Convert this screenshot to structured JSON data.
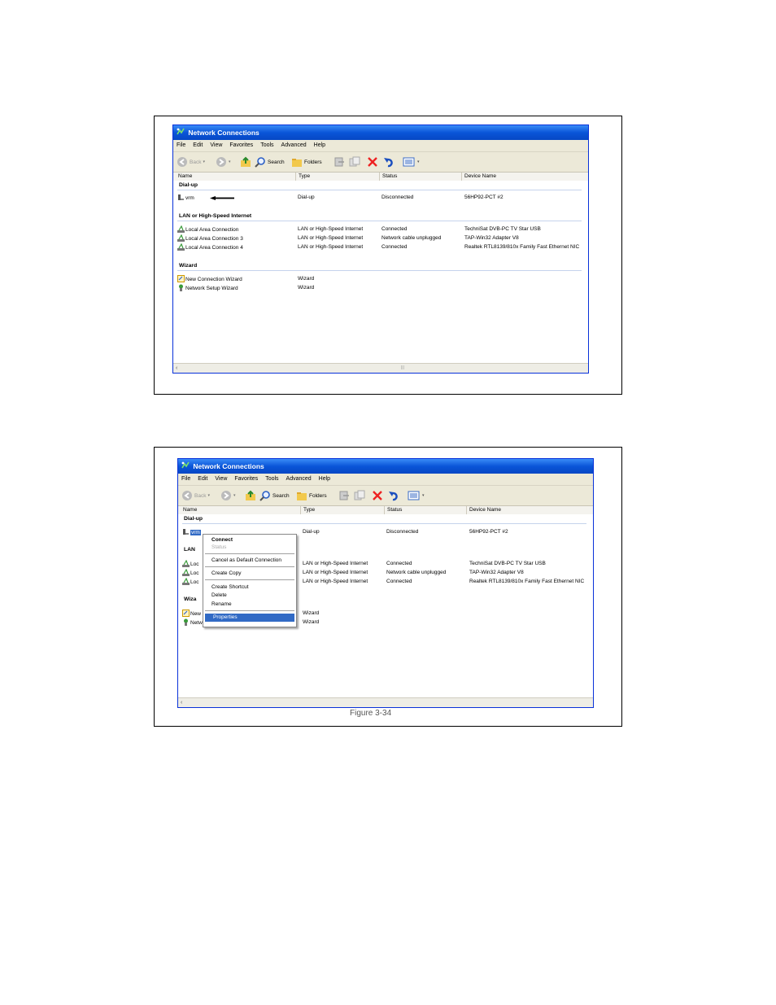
{
  "window": {
    "title": "Network Connections"
  },
  "menu": [
    "File",
    "Edit",
    "View",
    "Favorites",
    "Tools",
    "Advanced",
    "Help"
  ],
  "toolbar": {
    "back": "Back",
    "search": "Search",
    "folders": "Folders"
  },
  "columns": [
    "Name",
    "Type",
    "Status",
    "Device Name"
  ],
  "groups": {
    "dialup": "Dial-up",
    "lan": "LAN or High-Speed Internet",
    "wizard": "Wizard"
  },
  "dialup_row": {
    "name": "vrm",
    "type": "Dial-up",
    "status": "Disconnected",
    "device": "56HP92-PCT #2"
  },
  "lan_rows": [
    {
      "name": "Local Area Connection",
      "type": "LAN or High-Speed Internet",
      "status": "Connected",
      "device": "TechniSat DVB-PC TV Star USB"
    },
    {
      "name": "Local Area Connection 3",
      "type": "LAN or High-Speed Internet",
      "status": "Network cable unplugged",
      "device": "TAP-Win32 Adapter V8"
    },
    {
      "name": "Local Area Connection 4",
      "type": "LAN or High-Speed Internet",
      "status": "Connected",
      "device": "Realtek RTL8139/810x Family Fast Ethernet NIC"
    }
  ],
  "wizard_rows": [
    {
      "name": "New Connection Wizard",
      "type": "Wizard"
    },
    {
      "name": "Network Setup Wizard",
      "type": "Wizard"
    }
  ],
  "truncated": {
    "lan_row": "Loc",
    "wizard_group": "Wiza",
    "new_wizard": "New",
    "lan_group": "LAN"
  },
  "context_menu": {
    "connect": "Connect",
    "status": "Status",
    "cancel_default": "Cancel as Default Connection",
    "create_copy": "Create Copy",
    "create_shortcut": "Create Shortcut",
    "delete": "Delete",
    "rename": "Rename",
    "properties": "Properties"
  },
  "caption": "Figure 3-34",
  "colors": {
    "titlebar": "#0a55d8",
    "chrome": "#ece9d8",
    "selection": "#316ac5"
  }
}
